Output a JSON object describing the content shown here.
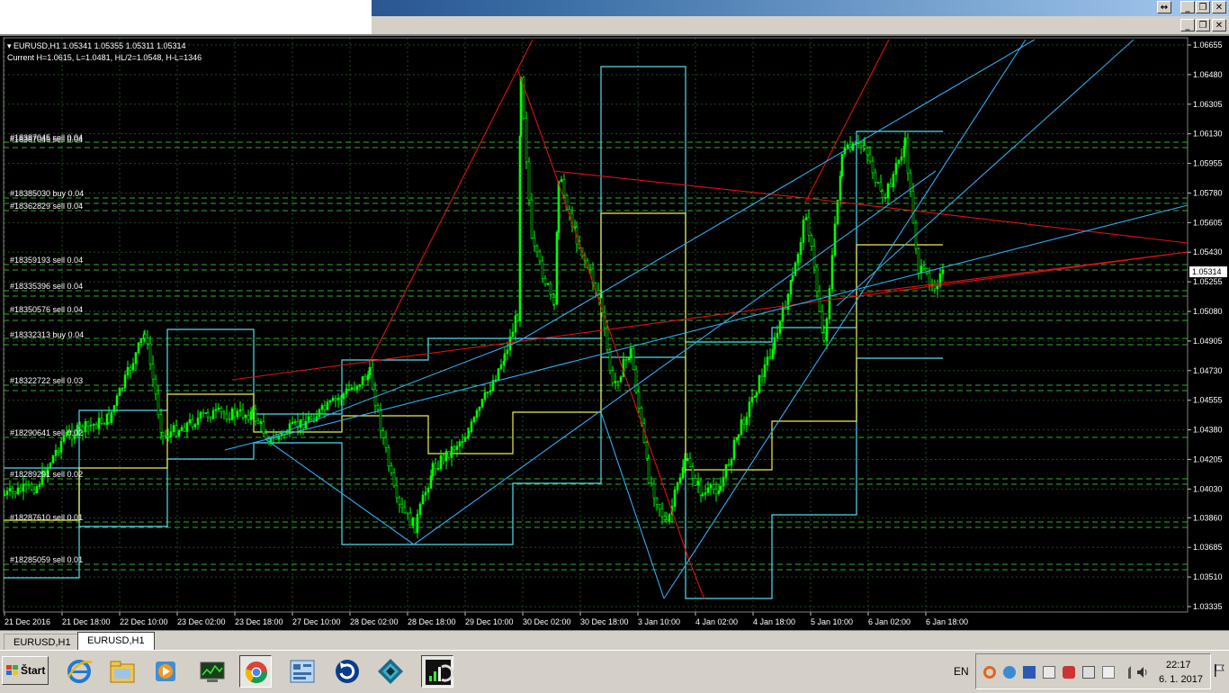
{
  "symbol_header": {
    "line1": "EURUSD,H1  1.05341 1.05355 1.05311 1.05314",
    "line2": "Current H=1.0615, L=1.0481, HL/2=1.0548, H-L=1346"
  },
  "window_buttons": {
    "outer": [
      "↔",
      "_",
      "❐",
      "✕"
    ],
    "inner": [
      "_",
      "❐",
      "✕"
    ]
  },
  "price_axis": {
    "ticks": [
      "1.06655",
      "1.06480",
      "1.06305",
      "1.06130",
      "1.05955",
      "1.05780",
      "1.05605",
      "1.05430",
      "1.05255",
      "1.05080",
      "1.04905",
      "1.04730",
      "1.04555",
      "1.04380",
      "1.04205",
      "1.04030",
      "1.03860",
      "1.03685",
      "1.03510",
      "1.03335"
    ],
    "current_price": "1.05314"
  },
  "time_axis": {
    "ticks": [
      "21 Dec 2016",
      "21 Dec 18:00",
      "22 Dec 10:00",
      "23 Dec 02:00",
      "23 Dec 18:00",
      "27 Dec 10:00",
      "28 Dec 02:00",
      "28 Dec 18:00",
      "29 Dec 10:00",
      "30 Dec 02:00",
      "30 Dec 18:00",
      "3 Jan 10:00",
      "4 Jan 02:00",
      "4 Jan 18:00",
      "5 Jan 10:00",
      "6 Jan 02:00",
      "6 Jan 18:00"
    ]
  },
  "order_labels": [
    "#18387045 sell 0.04",
    "#18385030 buy 0.04",
    "#18362829 sell 0.04",
    "#18359193 sell 0.04",
    "#18335396 sell 0.04",
    "#18350576 sell 0.04",
    "#18332313 buy 0.04",
    "#18322722 sell 0.03",
    "#18290641 sell 0.02",
    "#18289291 sell 0.02",
    "#18287610 sell 0.01",
    "#18285059 sell 0.01"
  ],
  "tabs": [
    "EURUSD,H1",
    "EURUSD,H1"
  ],
  "taskbar": {
    "start_label": "Štart",
    "language": "EN",
    "time": "22:17",
    "date": "6. 1. 2017",
    "apps": [
      "internet-explorer-icon",
      "file-explorer-icon",
      "media-player-icon",
      "task-manager-icon",
      "chrome-icon",
      "network-panel-icon",
      "refresh-app-icon",
      "diamond-app-icon",
      "metatrader-icon"
    ]
  },
  "colors": {
    "chart_bg": "#000000",
    "candles": "#00ff00",
    "grid": "#1f4a1f",
    "order_lines": "#33aa33",
    "trend_red": "#dd1111",
    "trend_blue": "#33aaee",
    "channel_cyan": "#55ddee",
    "channel_yellow": "#eeee55"
  }
}
